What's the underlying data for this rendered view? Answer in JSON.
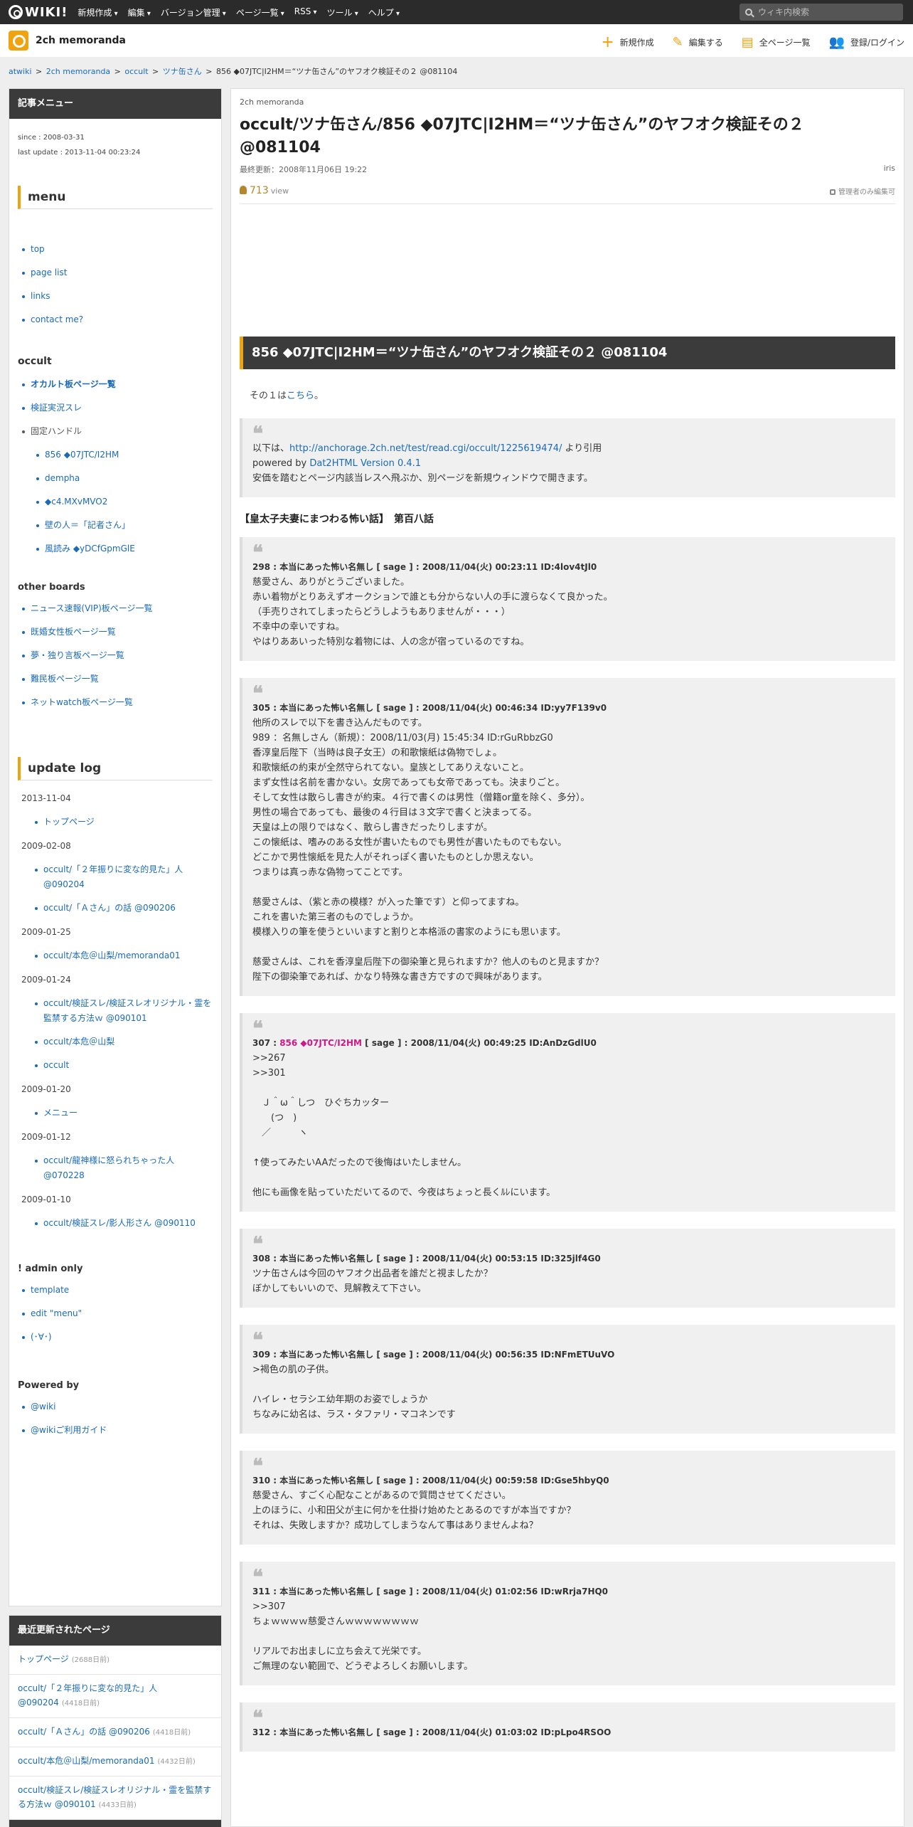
{
  "topbar": {
    "logo": "WIKI!",
    "nav": [
      "新規作成",
      "編集",
      "バージョン管理",
      "ページ一覧",
      "RSS",
      "ツール",
      "ヘルプ"
    ],
    "search_placeholder": "ウィキ内検索"
  },
  "header": {
    "site_title": "2ch memoranda",
    "actions": [
      {
        "icon": "plus-icon",
        "label": "新規作成"
      },
      {
        "icon": "pencil-icon",
        "label": "編集する"
      },
      {
        "icon": "document-icon",
        "label": "全ページ一覧"
      },
      {
        "icon": "user-add-icon",
        "label": "登録/ログイン"
      }
    ]
  },
  "breadcrumb": {
    "items": [
      "atwiki",
      "2ch memoranda",
      "occult",
      "ツナ缶さん"
    ],
    "current": "856 ◆07JTC|I2HM＝“ツナ缶さん”のヤフオク検証その２ @081104"
  },
  "sidebar": {
    "menu_head": "記事メニュー",
    "since": "since : 2008-03-31",
    "last_update": "last update : 2013-11-04 00:23:24",
    "menu_title": "menu",
    "menu_items": [
      "top",
      "page list",
      "links",
      "contact me?"
    ],
    "occult_title": "occult",
    "occult_items": [
      "オカルト板ページ一覧",
      "検証実況スレ"
    ],
    "fixed_handle": "固定ハンドル",
    "handle_items": [
      "856 ◆07JTC/I2HM",
      "dempha",
      "◆c4.MXvMVO2",
      "壁の人＝「記者さん」",
      "風読み ◆yDCfGpmGlE"
    ],
    "other_title": "other boards",
    "other_items": [
      "ニュース速報(VIP)板ページ一覧",
      "既婚女性板ページ一覧",
      "夢・独り言板ページ一覧",
      "難民板ページ一覧",
      "ネットwatch板ページ一覧"
    ],
    "update_title": "update log",
    "update_groups": [
      {
        "date": "2013-11-04",
        "items": [
          "トップページ"
        ]
      },
      {
        "date": "2009-02-08",
        "items": [
          "occult/「２年振りに変な的見た」人 @090204",
          "occult/「Ａさん」の話 @090206"
        ]
      },
      {
        "date": "2009-01-25",
        "items": [
          "occult/本危＠山梨/memoranda01"
        ]
      },
      {
        "date": "2009-01-24",
        "items": [
          "occult/検証スレ/検証スレオリジナル・霊を監禁する方法ｗ @090101",
          "occult/本危＠山梨",
          "occult"
        ]
      },
      {
        "date": "2009-01-20",
        "items": [
          "メニュー"
        ]
      },
      {
        "date": "2009-01-12",
        "items": [
          "occult/龍神様に怒られちゃった人 @070228"
        ]
      },
      {
        "date": "2009-01-10",
        "items": [
          "occult/検証スレ/影人形さん @090110"
        ]
      }
    ],
    "admin_title": "! admin only",
    "admin_items": [
      "template",
      "edit \"menu\"",
      "(･∀･)"
    ],
    "powered_title": "Powered by",
    "powered_items": [
      "@wiki",
      "@wikiご利用ガイド"
    ],
    "recent_head": "最近更新されたページ",
    "recent_items": [
      {
        "title": "トップページ",
        "ago": "(2688日前)"
      },
      {
        "title": "occult/「２年振りに変な的見た」人 @090204",
        "ago": "(4418日前)"
      },
      {
        "title": "occult/「Ａさん」の話 @090206",
        "ago": "(4418日前)"
      },
      {
        "title": "occult/本危＠山梨/memoranda01",
        "ago": "(4432日前)"
      },
      {
        "title": "occult/検証スレ/検証スレオリジナル・霊を監禁する方法ｗ @090101",
        "ago": "(4433日前)"
      }
    ]
  },
  "main": {
    "crumb": "2ch memoranda",
    "title": "occult/ツナ缶さん/856 ◆07JTC|I2HM＝“ツナ缶さん”のヤフオク検証その２ @081104",
    "updated": "最終更新：2008年11月06日 19:22",
    "author": "iris",
    "views": "713",
    "views_unit": "view",
    "lock_text": "管理者のみ編集可",
    "section_header": "856 ◆07JTC|I2HM＝“ツナ缶さん”のヤフオク検証その２ @081104",
    "intro_prefix": "その１は",
    "intro_link": "こちら",
    "intro_suffix": "。",
    "source": {
      "line1_prefix": "以下は、",
      "line1_link": "http://anchorage.2ch.net/test/read.cgi/occult/1225619474/",
      "line1_suffix": " より引用",
      "line2_prefix": "powered by ",
      "line2_link": "Dat2HTML Version 0.4.1",
      "line3": "安価を踏むとページ内該当レスへ飛ぶか、別ページを新規ウィンドウで開きます。"
    },
    "story_title": "【皇太子夫妻にまつわる怖い話】　第百八話",
    "posts": [
      {
        "head": "298 : 本当にあった怖い名無し [ sage ] : 2008/11/04(火) 00:23:11 ID:4lov4tJl0",
        "lines": [
          "慈愛さん、ありがとうございました。",
          "赤い着物がとりあえずオークションで誰とも分からない人の手に渡らなくて良かった。",
          "（手売りされてしまったらどうしようもありませんが・・・）",
          "不幸中の幸いですね。",
          "やはりああいった特別な着物には、人の念が宿っているのですね。"
        ]
      },
      {
        "head": "305 : 本当にあった怖い名無し [ sage ] : 2008/11/04(火) 00:46:34 ID:yy7F139v0",
        "lines": [
          "他所のスレで以下を書き込んだものです。",
          "989 ：名無しさん（新規）：2008/11/03(月) 15:45:34 ID:rGuRbbzG0",
          "香淳皇后陛下（当時は良子女王）の和歌懐紙は偽物でしょ。",
          "和歌懐紙の約束が全然守られてない。皇族としてありえないこと。",
          "まず女性は名前を書かない。女房であっても女帝であっても。決まりごと。",
          "そして女性は散らし書きが約束。４行で書くのは男性（僧籍or童を除く、多分）。",
          "男性の場合であっても、最後の４行目は３文字で書くと決まってる。",
          "天皇は上の限りではなく、散らし書きだったりしますが。",
          "この懐紙は、嗜みのある女性が書いたものでも男性が書いたものでもない。",
          "どこかで男性懐紙を見た人がそれっぽく書いたものとしか思えない。",
          "つまりは真っ赤な偽物ってことです。",
          "",
          "慈愛さんは、（紫と赤の模様？が入った筆です）と仰ってますね。",
          "これを書いた第三者のものでしょうか。",
          "模様入りの筆を使うといいますと割りと本格派の書家のようにも思います。",
          "",
          "慈愛さんは、これを香淳皇后陛下の御染筆と見られますか？他人のものと見ますか？",
          "陛下の御染筆であれば、かなり特殊な書き方ですので興味があります。"
        ]
      },
      {
        "head_prefix": "307 : ",
        "head_trip": "856 ◆07JTC/I2HM",
        "head_suffix": " [ sage ] : 2008/11/04(火) 00:49:25 ID:AnDzGdlU0",
        "anchors": [
          ">>267",
          ">>301"
        ],
        "lines": [
          "",
          "　Ｊ＾ω＾しつ　ひぐちカッター",
          "　　(つ　)",
          "　／　　　ヽ",
          "",
          "↑使ってみたいAAだったので後悔はいたしません。",
          "",
          "他にも画像を貼っていただいてるので、今夜はちょっと長くﾙﾚにいます。"
        ]
      },
      {
        "head": "308 : 本当にあった怖い名無し [ sage ] : 2008/11/04(火) 00:53:15 ID:325jlf4G0",
        "lines": [
          "ツナ缶さんは今回のヤフオク出品者を誰だと視ましたか？",
          "ぼかしてもいいので、見解教えて下さい。"
        ]
      },
      {
        "head": "309 : 本当にあった怖い名無し [ sage ] : 2008/11/04(火) 00:56:35 ID:NFmETUuVO",
        "lines": [
          ">褐色の肌の子供。",
          "",
          "ハイレ・セラシエ幼年期のお姿でしょうか",
          "ちなみに幼名は、ラス・タファリ・マコネンです"
        ]
      },
      {
        "head": "310 : 本当にあった怖い名無し [ sage ] : 2008/11/04(火) 00:59:58 ID:Gse5hbyQ0",
        "lines": [
          "慈愛さん、すごく心配なことがあるので質問させてください。",
          "上のほうに、小和田父が主に何かを仕掛け始めたとあるのですが本当ですか？",
          "それは、失敗しますか？成功してしまうなんて事はありませんよね？"
        ]
      },
      {
        "head": "311 : 本当にあった怖い名無し [ sage ] : 2008/11/04(火) 01:02:56 ID:wRrja7HQ0",
        "anchors": [
          ">>307"
        ],
        "lines": [
          "ちょｗｗｗｗ慈愛さんｗｗｗｗｗｗｗｗ",
          "",
          "リアルでお出ましに立ち会えて光栄です。",
          "ご無理のない範囲で、どうぞよろしくお願いします。"
        ]
      },
      {
        "head": "312 : 本当にあった怖い名無し [ sage ] : 2008/11/04(火) 01:03:02 ID:pLpo4RSOO",
        "lines": []
      }
    ]
  }
}
